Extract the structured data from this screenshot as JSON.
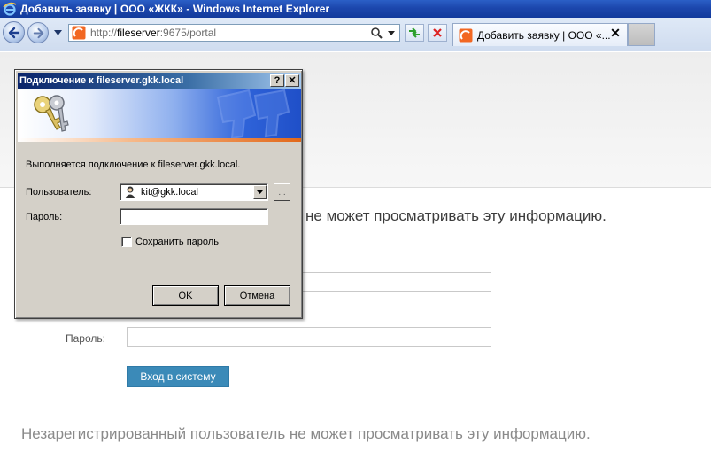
{
  "window": {
    "title": "Добавить заявку | ООО «ЖКК» - Windows Internet Explorer"
  },
  "navbar": {
    "url_prefix": "http://",
    "url_host": "fileserver",
    "url_rest": ":9675/portal",
    "tab_title": "Добавить заявку | ООО «...",
    "tab_close": "✕"
  },
  "page": {
    "warning_top": "не может просматривать эту информацию.",
    "password_label": "Пароль:",
    "login_button": "Вход в систему",
    "warning_bottom": "Незарегистрированный пользователь не может просматривать эту информацию."
  },
  "dialog": {
    "title": "Подключение к fileserver.gkk.local",
    "help_button": "?",
    "close_button": "✕",
    "message": "Выполняется подключение к fileserver.gkk.local.",
    "user_label": "Пользователь:",
    "user_value": "kit@gkk.local",
    "browse_button": "...",
    "password_label": "Пароль:",
    "password_value": "",
    "remember_label": "Сохранить пароль",
    "remember_checked": false,
    "ok_button": "OK",
    "cancel_button": "Отмена"
  },
  "colors": {
    "titlebar": "#1c47ad",
    "login_button": "#3b8ab8",
    "dialog_face": "#d4d0c8"
  }
}
